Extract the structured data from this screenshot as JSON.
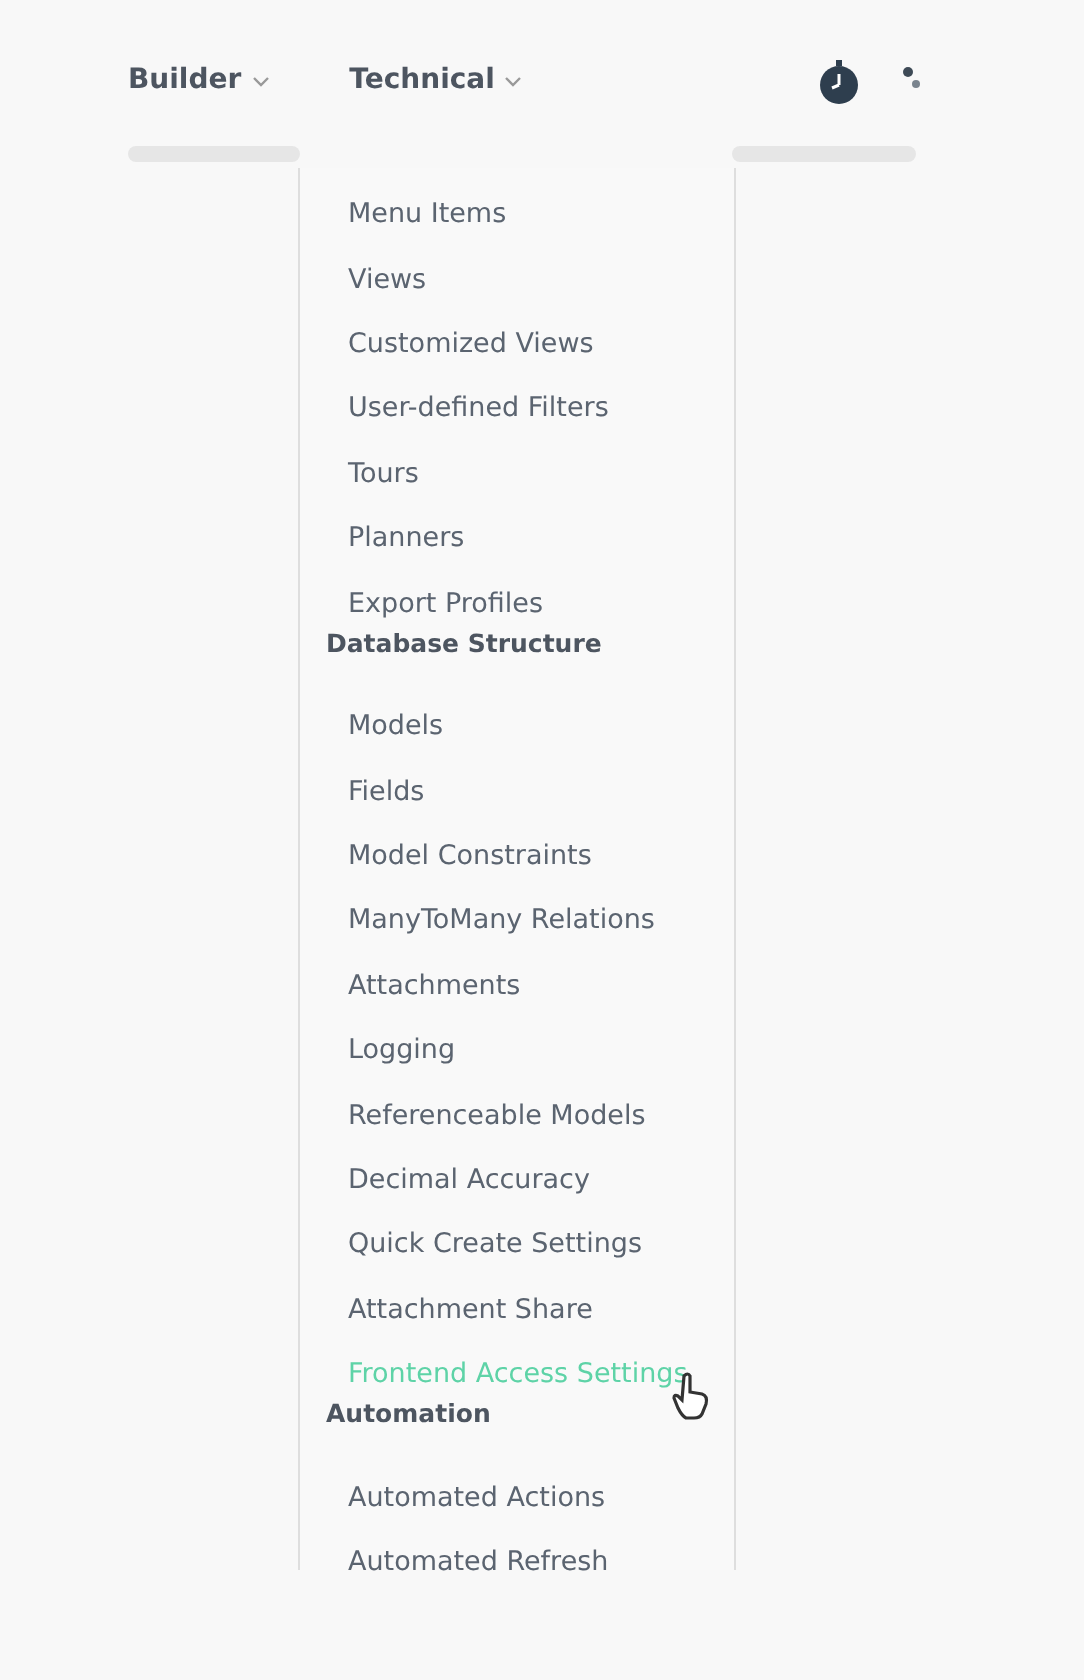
{
  "nav": [
    {
      "label": "Builder"
    },
    {
      "label": "Technical"
    }
  ],
  "menu": {
    "sections": [
      {
        "items": [
          {
            "label": "Menu Items",
            "highlighted": false
          },
          {
            "label": "Views",
            "highlighted": false
          },
          {
            "label": "Customized Views",
            "highlighted": false
          },
          {
            "label": "User-defined Filters",
            "highlighted": false
          },
          {
            "label": "Tours",
            "highlighted": false
          },
          {
            "label": "Planners",
            "highlighted": false
          },
          {
            "label": "Export Profiles",
            "highlighted": false
          }
        ]
      },
      {
        "heading": "Database Structure",
        "items": [
          {
            "label": "Models",
            "highlighted": false
          },
          {
            "label": "Fields",
            "highlighted": false
          },
          {
            "label": "Model Constraints",
            "highlighted": false
          },
          {
            "label": "ManyToMany Relations",
            "highlighted": false
          },
          {
            "label": "Attachments",
            "highlighted": false
          },
          {
            "label": "Logging",
            "highlighted": false
          },
          {
            "label": "Referenceable Models",
            "highlighted": false
          },
          {
            "label": "Decimal Accuracy",
            "highlighted": false
          },
          {
            "label": "Quick Create Settings",
            "highlighted": false
          },
          {
            "label": "Attachment Share",
            "highlighted": false
          },
          {
            "label": "Frontend Access Settings",
            "highlighted": true
          }
        ]
      },
      {
        "heading": "Automation",
        "items": [
          {
            "label": "Automated Actions",
            "highlighted": false
          },
          {
            "label": "Automated Refresh",
            "highlighted": false
          }
        ]
      }
    ]
  }
}
